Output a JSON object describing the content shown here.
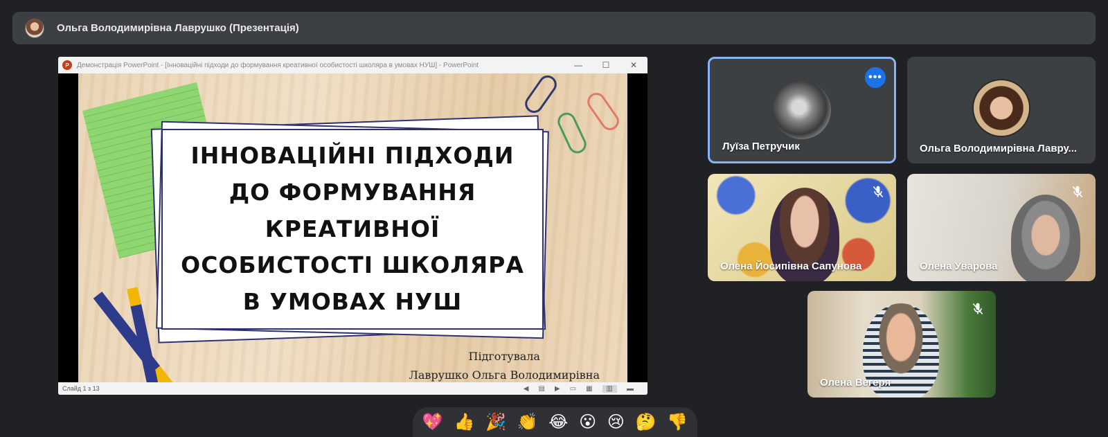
{
  "presenter_bar": {
    "title": "Ольга Володимирівна Лаврушко (Презентація)"
  },
  "ppt": {
    "window_title": "Демонстрація PowerPoint - [Інноваційні підходи до формування креативної особистості школяра в умовах НУШ] - PowerPoint",
    "logo_letter": "P",
    "minimize": "—",
    "maximize": "☐",
    "close": "✕",
    "slide_title": "ІННОВАЦІЙНІ ПІДХОДИ ДО ФОРМУВАННЯ КРЕАТИВНОЇ ОСОБИСТОСТІ ШКОЛЯРА В УМОВАХ НУШ",
    "credit_line1": "Підготувала",
    "credit_line2": "Лаврушко Ольга Володимирівна",
    "status": "Слайд 1 з 13",
    "status_icons": [
      "◀",
      "▤",
      "▶",
      "▭",
      "▦",
      "▥",
      "▬"
    ]
  },
  "tiles": [
    {
      "name": "Луїза Петручик",
      "more_label": "•••"
    },
    {
      "name": "Ольга Володимирівна Лавру..."
    },
    {
      "name": "Олена Йосипівна Сапунова"
    },
    {
      "name": "Олена Уварова"
    },
    {
      "name": "Олена Вегеря"
    }
  ],
  "reactions": [
    "💖",
    "👍",
    "🎉",
    "👏",
    "😂",
    "😮",
    "😢",
    "🤔",
    "👎"
  ],
  "colors": {
    "background": "#202124",
    "tile": "#3c4043",
    "active_border": "#8ab4f8",
    "accent_blue": "#1a73e8"
  }
}
